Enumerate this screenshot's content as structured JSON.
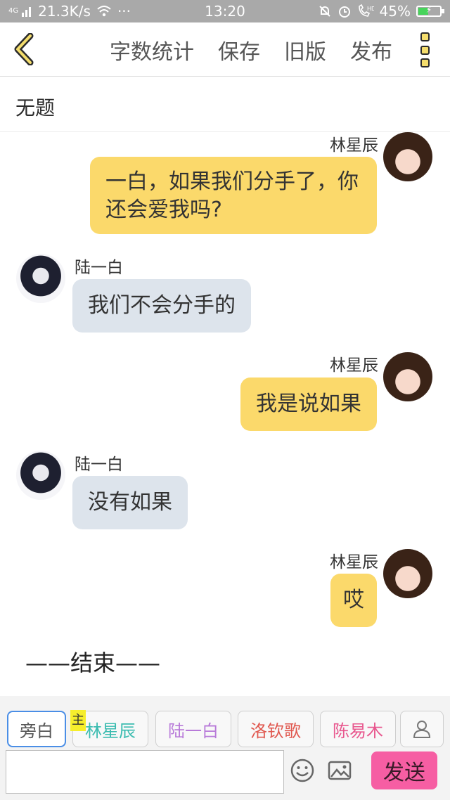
{
  "status_bar": {
    "network_tag": "4G",
    "speed": "21.3K/s",
    "more": "···",
    "time": "13:20",
    "battery": "45%",
    "battery_level": 0.45
  },
  "toolbar": {
    "word_count_label": "字数统计",
    "save_label": "保存",
    "old_version_label": "旧版",
    "publish_label": "发布"
  },
  "story": {
    "title": "无题"
  },
  "messages": [
    {
      "sender": "林星辰",
      "text": "一白，如果我们分手了，你还会爱我吗?"
    },
    {
      "sender": "陆一白",
      "text": "我们不会分手的"
    },
    {
      "sender": "林星辰",
      "text": "我是说如果"
    },
    {
      "sender": "陆一白",
      "text": "没有如果"
    },
    {
      "sender": "林星辰",
      "text": "哎"
    }
  ],
  "end_text": "——结束——",
  "roles": {
    "narration": "旁白",
    "main_tag": "主",
    "items": [
      {
        "name": "林星辰",
        "color": "#3bbcb0"
      },
      {
        "name": "陆一白",
        "color": "#b87ad9"
      },
      {
        "name": "洛钦歌",
        "color": "#e0584f"
      },
      {
        "name": "陈易木",
        "color": "#e8578e"
      }
    ]
  },
  "composer": {
    "input_value": "",
    "send_label": "发送"
  },
  "colors": {
    "accent_yellow": "#fbd96b",
    "bubble_gray": "#dde4ec",
    "send_pink": "#f65ea3"
  }
}
